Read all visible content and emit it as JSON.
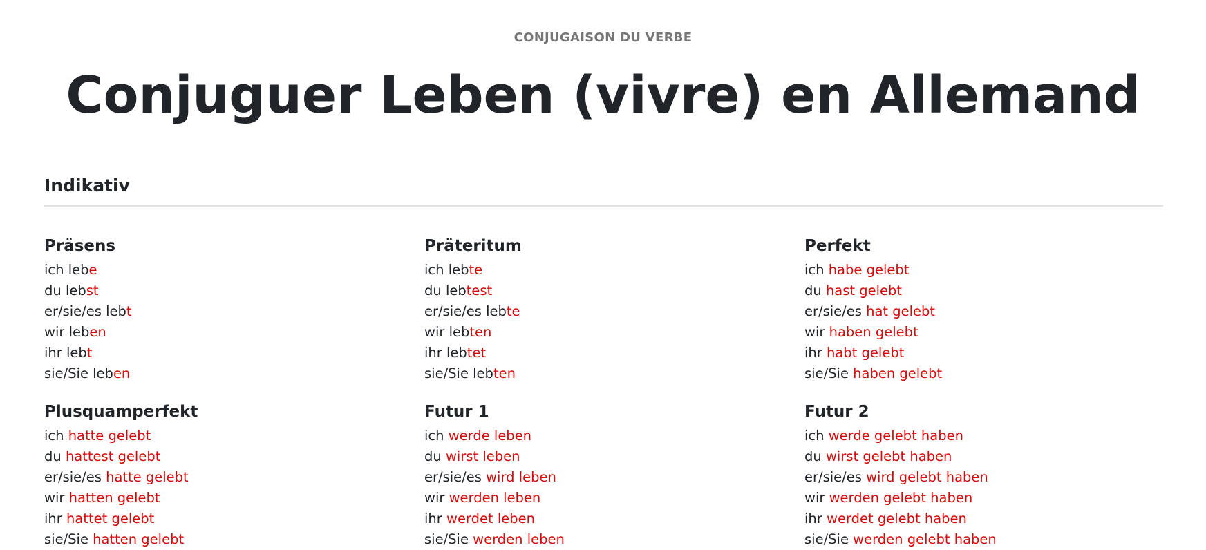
{
  "header": {
    "eyebrow": "CONJUGAISON DU VERBE",
    "title": "Conjuguer Leben (vivre) en Allemand"
  },
  "section": {
    "title": "Indikativ"
  },
  "colors": {
    "accent": "#d60a0a",
    "text": "#212529",
    "muted": "#767676",
    "divider": "#e2e2e2"
  },
  "tenses": [
    {
      "name": "Präsens",
      "forms": [
        {
          "pronoun": "ich",
          "stem": "leb",
          "ending": "e"
        },
        {
          "pronoun": "du",
          "stem": "leb",
          "ending": "st"
        },
        {
          "pronoun": "er/sie/es",
          "stem": "leb",
          "ending": "t"
        },
        {
          "pronoun": "wir",
          "stem": "leb",
          "ending": "en"
        },
        {
          "pronoun": "ihr",
          "stem": "leb",
          "ending": "t"
        },
        {
          "pronoun": "sie/Sie",
          "stem": "leb",
          "ending": "en"
        }
      ]
    },
    {
      "name": "Präteritum",
      "forms": [
        {
          "pronoun": "ich",
          "stem": "leb",
          "ending": "te"
        },
        {
          "pronoun": "du",
          "stem": "leb",
          "ending": "test"
        },
        {
          "pronoun": "er/sie/es",
          "stem": "leb",
          "ending": "te"
        },
        {
          "pronoun": "wir",
          "stem": "leb",
          "ending": "ten"
        },
        {
          "pronoun": "ihr",
          "stem": "leb",
          "ending": "tet"
        },
        {
          "pronoun": "sie/Sie",
          "stem": "leb",
          "ending": "ten"
        }
      ]
    },
    {
      "name": "Perfekt",
      "forms": [
        {
          "pronoun": "ich",
          "stem": "",
          "ending": "habe gelebt"
        },
        {
          "pronoun": "du",
          "stem": "",
          "ending": "hast gelebt"
        },
        {
          "pronoun": "er/sie/es",
          "stem": "",
          "ending": "hat gelebt"
        },
        {
          "pronoun": "wir",
          "stem": "",
          "ending": "haben gelebt"
        },
        {
          "pronoun": "ihr",
          "stem": "",
          "ending": "habt gelebt"
        },
        {
          "pronoun": "sie/Sie",
          "stem": "",
          "ending": "haben gelebt"
        }
      ]
    },
    {
      "name": "Plusquamperfekt",
      "forms": [
        {
          "pronoun": "ich",
          "stem": "",
          "ending": "hatte gelebt"
        },
        {
          "pronoun": "du",
          "stem": "",
          "ending": "hattest gelebt"
        },
        {
          "pronoun": "er/sie/es",
          "stem": "",
          "ending": "hatte gelebt"
        },
        {
          "pronoun": "wir",
          "stem": "",
          "ending": "hatten gelebt"
        },
        {
          "pronoun": "ihr",
          "stem": "",
          "ending": "hattet gelebt"
        },
        {
          "pronoun": "sie/Sie",
          "stem": "",
          "ending": "hatten gelebt"
        }
      ]
    },
    {
      "name": "Futur 1",
      "forms": [
        {
          "pronoun": "ich",
          "stem": "",
          "ending": "werde leben"
        },
        {
          "pronoun": "du",
          "stem": "",
          "ending": "wirst leben"
        },
        {
          "pronoun": "er/sie/es",
          "stem": "",
          "ending": "wird leben"
        },
        {
          "pronoun": "wir",
          "stem": "",
          "ending": "werden leben"
        },
        {
          "pronoun": "ihr",
          "stem": "",
          "ending": "werdet leben"
        },
        {
          "pronoun": "sie/Sie",
          "stem": "",
          "ending": "werden leben"
        }
      ]
    },
    {
      "name": "Futur 2",
      "forms": [
        {
          "pronoun": "ich",
          "stem": "",
          "ending": "werde gelebt haben"
        },
        {
          "pronoun": "du",
          "stem": "",
          "ending": "wirst gelebt haben"
        },
        {
          "pronoun": "er/sie/es",
          "stem": "",
          "ending": "wird gelebt haben"
        },
        {
          "pronoun": "wir",
          "stem": "",
          "ending": "werden gelebt haben"
        },
        {
          "pronoun": "ihr",
          "stem": "",
          "ending": "werdet gelebt haben"
        },
        {
          "pronoun": "sie/Sie",
          "stem": "",
          "ending": "werden gelebt haben"
        }
      ]
    }
  ]
}
